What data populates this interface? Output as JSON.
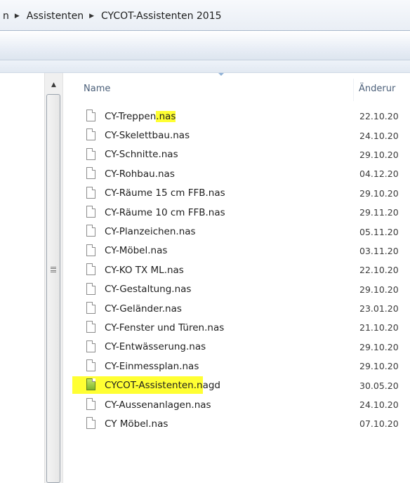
{
  "breadcrumb": {
    "partial": "n",
    "items": [
      "Assistenten",
      "CYCOT-Assistenten 2015"
    ]
  },
  "columns": {
    "name": "Name",
    "date": "Änderur"
  },
  "files": [
    {
      "name_main": "CY-Treppen",
      "name_hl": ".nas",
      "date": "22.10.20",
      "type": "nas"
    },
    {
      "name_main": "CY-Skelettbau.nas",
      "name_hl": "",
      "date": "24.10.20",
      "type": "nas"
    },
    {
      "name_main": "CY-Schnitte.nas",
      "name_hl": "",
      "date": "29.10.20",
      "type": "nas"
    },
    {
      "name_main": "CY-Rohbau.nas",
      "name_hl": "",
      "date": "04.12.20",
      "type": "nas"
    },
    {
      "name_main": "CY-Räume 15 cm FFB.nas",
      "name_hl": "",
      "date": "29.10.20",
      "type": "nas"
    },
    {
      "name_main": "CY-Räume 10 cm FFB.nas",
      "name_hl": "",
      "date": "29.11.20",
      "type": "nas"
    },
    {
      "name_main": "CY-Planzeichen.nas",
      "name_hl": "",
      "date": "05.11.20",
      "type": "nas"
    },
    {
      "name_main": "CY-Möbel.nas",
      "name_hl": "",
      "date": "03.11.20",
      "type": "nas"
    },
    {
      "name_main": "CY-KO TX ML.nas",
      "name_hl": "",
      "date": "22.10.20",
      "type": "nas"
    },
    {
      "name_main": "CY-Gestaltung.nas",
      "name_hl": "",
      "date": "29.10.20",
      "type": "nas"
    },
    {
      "name_main": "CY-Geländer.nas",
      "name_hl": "",
      "date": "23.01.20",
      "type": "nas"
    },
    {
      "name_main": "CY-Fenster und Türen.nas",
      "name_hl": "",
      "date": "21.10.20",
      "type": "nas"
    },
    {
      "name_main": "CY-Entwässerung.nas",
      "name_hl": "",
      "date": "29.10.20",
      "type": "nas"
    },
    {
      "name_main": "CY-Einmessplan.nas",
      "name_hl": "",
      "date": "29.10.20",
      "type": "nas"
    },
    {
      "name_main": "CYCOT-Assistenten.nagd",
      "name_hl": "",
      "date": "30.05.20",
      "type": "nagd"
    },
    {
      "name_main": "CY-Aussenanlagen.nas",
      "name_hl": "",
      "date": "24.10.20",
      "type": "nas"
    },
    {
      "name_main": "CY Möbel.nas",
      "name_hl": "",
      "date": "07.10.20",
      "type": "nas"
    }
  ],
  "colors": {
    "highlight": "#ffff33",
    "header_text": "#4c607a"
  }
}
